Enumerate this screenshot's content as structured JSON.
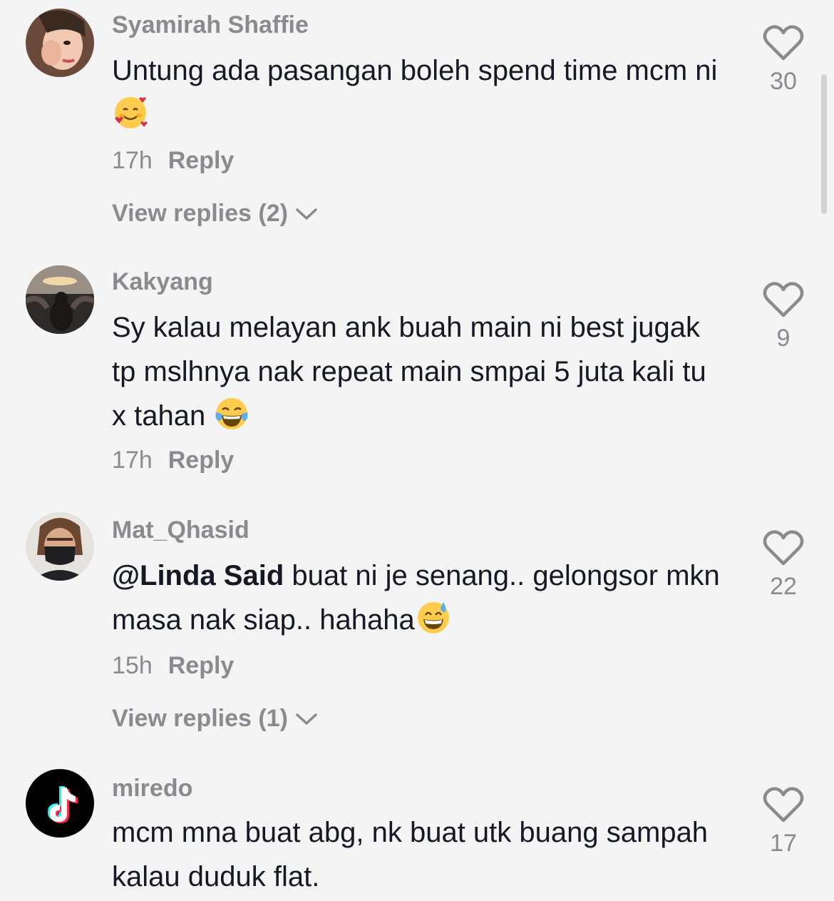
{
  "comments": [
    {
      "username": "Syamirah Shaffie",
      "text": "Untung ada pasangan boleh spend time mcm ni",
      "emoji": "smiling-face-with-hearts",
      "time": "17h",
      "reply_label": "Reply",
      "likes": "30",
      "view_replies": "View replies (2)"
    },
    {
      "username": "Kakyang",
      "text": "Sy kalau melayan ank buah main ni best jugak tp mslhnya nak repeat main smpai 5 juta kali tu x tahan ",
      "emoji": "face-with-tears-of-joy",
      "time": "17h",
      "reply_label": "Reply",
      "likes": "9"
    },
    {
      "username": "Mat_Qhasid",
      "mention": "@Linda Said",
      "text": " buat ni je senang.. gelongsor mkn masa nak siap.. hahaha",
      "emoji": "grinning-face-with-sweat",
      "time": "15h",
      "reply_label": "Reply",
      "likes": "22",
      "view_replies": "View replies (1)"
    },
    {
      "username": "miredo",
      "text": "mcm mna buat abg, nk buat utk buang sampah kalau duduk flat.",
      "likes": "17"
    }
  ],
  "icons": {
    "like": "heart-outline-icon",
    "expand": "chevron-down-icon"
  },
  "colors": {
    "background": "#f4f4f4",
    "primary_text": "#161823",
    "secondary_text": "#8a8a8f"
  }
}
